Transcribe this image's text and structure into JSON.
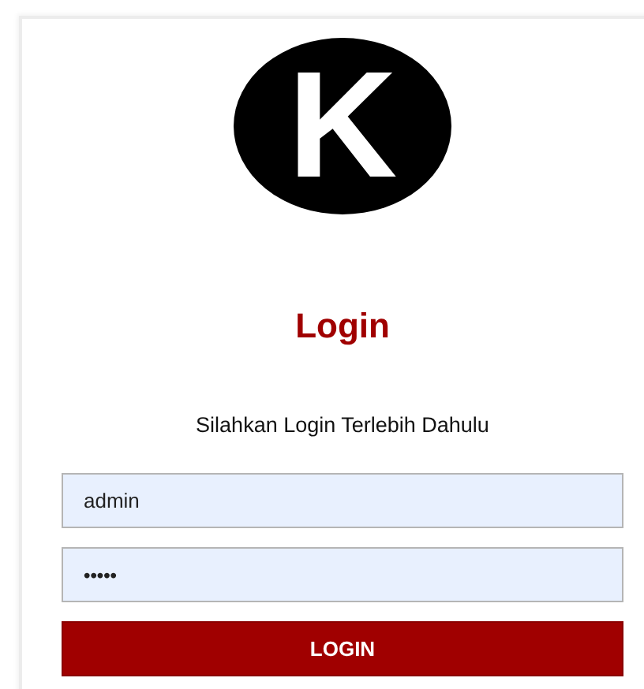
{
  "logo": {
    "letter": "K"
  },
  "title": "Login",
  "subtitle": "Silahkan Login Terlebih Dahulu",
  "fields": [
    {
      "kind": "username",
      "value": "admin"
    },
    {
      "kind": "password",
      "value": "•••••"
    }
  ],
  "button": "LOGIN"
}
